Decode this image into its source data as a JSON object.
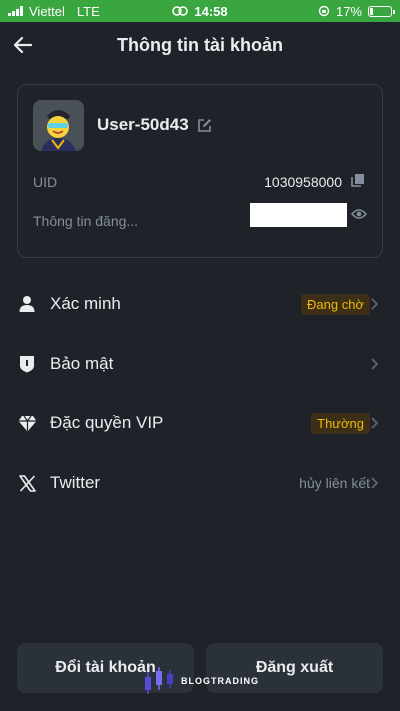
{
  "status_bar": {
    "carrier": "Viettel",
    "network": "LTE",
    "time": "14:58",
    "battery_percent": "17%",
    "battery_level": 0.17,
    "background_color": "#3aa63f"
  },
  "header": {
    "title": "Thông tin tài khoản",
    "back_icon": "arrow-left-icon"
  },
  "profile": {
    "username": "User-50d43",
    "uid_label": "UID",
    "uid_value": "1030958000",
    "info_label": "Thông tin đăng...",
    "edit_icon": "edit-icon",
    "copy_icon": "copy-icon",
    "eye_icon": "eye-icon"
  },
  "menu": [
    {
      "label": "Xác minh",
      "icon": "user-icon",
      "badge": "Đang chờ"
    },
    {
      "label": "Bảo mật",
      "icon": "shield-icon"
    },
    {
      "label": "Đặc quyền VIP",
      "icon": "diamond-icon",
      "badge": "Thường"
    },
    {
      "label": "Twitter",
      "icon": "x-logo-icon",
      "meta": "hủy liên kết"
    }
  ],
  "buttons": {
    "switch_account": "Đổi tài khoản",
    "logout": "Đăng xuất"
  },
  "watermark": {
    "text": "BLOGTRADING"
  },
  "colors": {
    "background": "#1f2329",
    "card_border": "#363b44",
    "button_bg": "#2b3139",
    "accent": "#f0b90b",
    "muted_text": "#848e9c",
    "primary_text": "#eaecef"
  }
}
